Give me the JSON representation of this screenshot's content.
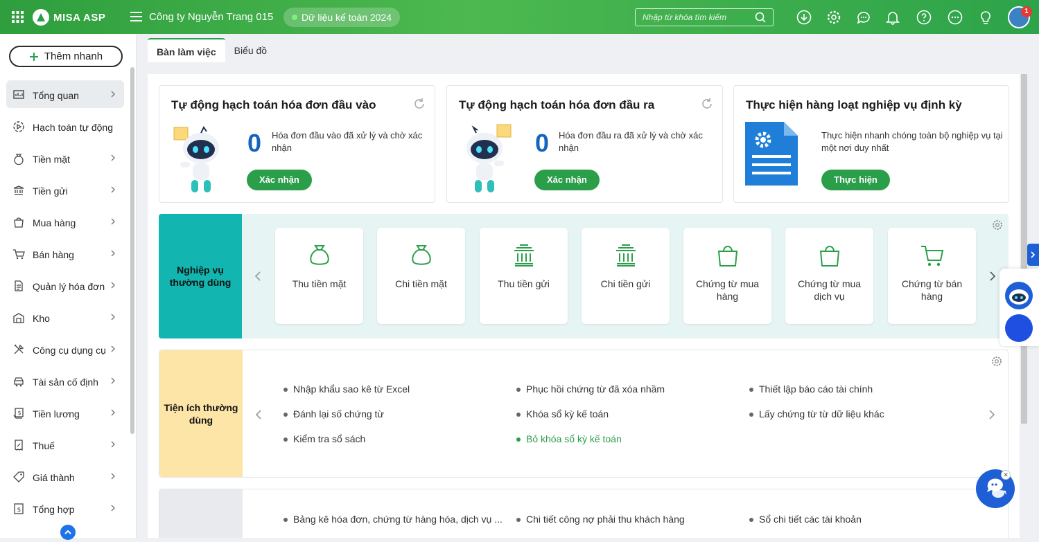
{
  "header": {
    "logo_text": "MISA ASP",
    "company": "Công ty Nguyễn Trang 015",
    "data_label": "Dữ liệu kế toán 2024",
    "search_placeholder": "Nhập từ khóa tìm kiếm",
    "notification_count": "1",
    "icons": [
      "download-icon",
      "settings-icon",
      "chat-icon",
      "bell-icon",
      "help-icon",
      "more-icon",
      "idea-icon"
    ]
  },
  "sidebar": {
    "quick_add": "Thêm nhanh",
    "items": [
      {
        "label": "Tổng quan",
        "icon": "dashboard-icon",
        "chevron": true,
        "active": true
      },
      {
        "label": "Hạch toán tự động",
        "icon": "auto-play-icon",
        "chevron": false
      },
      {
        "label": "Tiền mặt",
        "icon": "money-bag-icon",
        "chevron": true
      },
      {
        "label": "Tiền gửi",
        "icon": "bank-icon",
        "chevron": true
      },
      {
        "label": "Mua hàng",
        "icon": "shopping-bag-icon",
        "chevron": true
      },
      {
        "label": "Bán hàng",
        "icon": "cart-icon",
        "chevron": true
      },
      {
        "label": "Quản lý hóa đơn",
        "icon": "invoice-icon",
        "chevron": true
      },
      {
        "label": "Kho",
        "icon": "warehouse-icon",
        "chevron": true
      },
      {
        "label": "Công cụ dụng cụ",
        "icon": "tools-icon",
        "chevron": true
      },
      {
        "label": "Tài sản cố định",
        "icon": "asset-icon",
        "chevron": true
      },
      {
        "label": "Tiền lương",
        "icon": "payroll-icon",
        "chevron": true
      },
      {
        "label": "Thuế",
        "icon": "tax-icon",
        "chevron": true
      },
      {
        "label": "Giá thành",
        "icon": "price-tag-icon",
        "chevron": true
      },
      {
        "label": "Tổng hợp",
        "icon": "summary-icon",
        "chevron": true
      }
    ]
  },
  "tabs": [
    {
      "label": "Bàn làm việc",
      "active": true
    },
    {
      "label": "Biểu đồ",
      "active": false
    }
  ],
  "cards": [
    {
      "title": "Tự động hạch toán hóa đơn đầu vào",
      "count": "0",
      "desc": "Hóa đơn đầu vào đã xử lý và chờ xác nhận",
      "button": "Xác nhận"
    },
    {
      "title": "Tự động hạch toán hóa đơn đầu ra",
      "count": "0",
      "desc": "Hóa đơn đầu ra đã xử lý và chờ xác nhận",
      "button": "Xác nhận"
    },
    {
      "title": "Thực hiện hàng loạt nghiệp vụ định kỳ",
      "desc": "Thực hiện nhanh chóng toàn bộ nghiệp vụ tại một nơi duy nhất",
      "button": "Thực hiện"
    }
  ],
  "common_ops": {
    "label": "Nghiệp vụ thường dùng",
    "tiles": [
      {
        "label": "Thu tiền mặt",
        "icon": "money-bag-icon"
      },
      {
        "label": "Chi tiền mặt",
        "icon": "money-bag-icon"
      },
      {
        "label": "Thu tiền gửi",
        "icon": "bank-icon"
      },
      {
        "label": "Chi tiền gửi",
        "icon": "bank-icon"
      },
      {
        "label": "Chứng từ mua hàng",
        "icon": "shopping-bag-icon"
      },
      {
        "label": "Chứng từ mua dịch vụ",
        "icon": "shopping-bag-icon"
      },
      {
        "label": "Chứng từ bán hàng",
        "icon": "cart-icon"
      }
    ]
  },
  "utilities": {
    "label": "Tiện ích thường dùng",
    "items": [
      "Nhập khẩu sao kê từ Excel",
      "Phục hồi chứng từ đã xóa nhầm",
      "Thiết lập báo cáo tài chính",
      "Đánh lại số chứng từ",
      "Khóa sổ kỳ kế toán",
      "Lấy chứng từ từ dữ liệu khác",
      "Kiểm tra sổ sách",
      "Bỏ khóa sổ kỳ kế toán"
    ]
  },
  "reports": {
    "items": [
      "Bảng kê hóa đơn, chứng từ hàng hóa, dịch vụ ...",
      "Chi tiết công nợ phải thu khách hàng",
      "Sổ chi tiết các tài khoản"
    ]
  },
  "colors": {
    "brand": "#2b9e4a",
    "teal": "#12b5b0",
    "accent": "#1e5fd6",
    "count": "#1565c0",
    "cream": "#fde5a8"
  }
}
